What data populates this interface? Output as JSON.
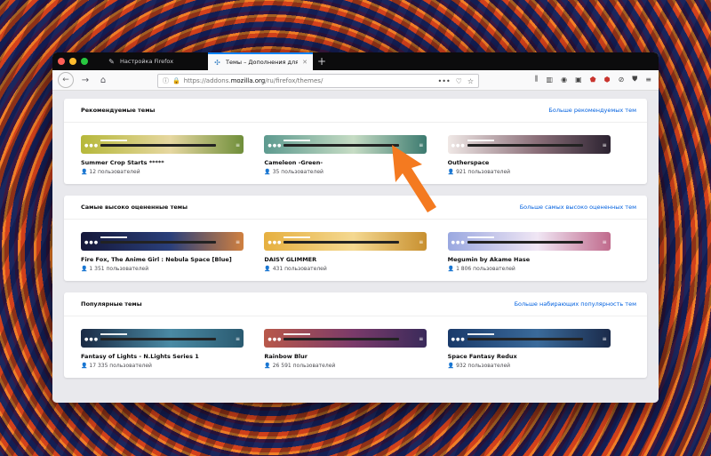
{
  "browser": {
    "tabs": [
      {
        "label": "Настройка Firefox",
        "icon": "wrench-icon",
        "close": "✕"
      },
      {
        "label": "Темы – Дополнения для Firefox",
        "icon": "puzzle-icon",
        "close": "✕"
      }
    ],
    "new_tab": "+",
    "url_prefix": "https://addons.",
    "url_domain": "mozilla.org",
    "url_path": "/ru/firefox/themes/",
    "page_actions": "•••"
  },
  "sections": [
    {
      "title": "Рекомендуемые темы",
      "more": "Больше рекомендуемых тем",
      "themes": [
        {
          "name": "Summer Crop Starts *****",
          "users": "12 пользователей",
          "colors": [
            "#b6b83a",
            "#e6d7a0",
            "#6f8e3a"
          ]
        },
        {
          "name": "Cameleon -Green-",
          "users": "35 пользователей",
          "colors": [
            "#5d9a8f",
            "#c6dcc4",
            "#3c7a6f"
          ]
        },
        {
          "name": "Outherspace",
          "users": "921 пользователей",
          "colors": [
            "#f0e8e6",
            "#8a6e78",
            "#2b2230"
          ]
        }
      ]
    },
    {
      "title": "Самые высоко оцененные темы",
      "more": "Больше самых высоко оцененных тем",
      "themes": [
        {
          "name": "Fire Fox, The Anime Girl : Nebula Space [Blue]",
          "users": "1 351 пользователей",
          "colors": [
            "#15183a",
            "#2a3f7a",
            "#d08040"
          ]
        },
        {
          "name": "DAISY GLIMMER",
          "users": "431 пользователей",
          "colors": [
            "#e6b040",
            "#f4d890",
            "#c89030"
          ]
        },
        {
          "name": "Megumin by Akame Hase",
          "users": "1 806 пользователей",
          "colors": [
            "#9aa8e0",
            "#f0e6f4",
            "#c06a8c"
          ]
        }
      ]
    },
    {
      "title": "Популярные темы",
      "more": "Больше набирающих популярность тем",
      "themes": [
        {
          "name": "Fantasy of Lights - N.Lights Series 1",
          "users": "17 335 пользователей",
          "colors": [
            "#1a2a44",
            "#4a8aa4",
            "#2a5a70"
          ]
        },
        {
          "name": "Rainbow Blur",
          "users": "26 591 пользователей",
          "colors": [
            "#b8584a",
            "#7a3a6a",
            "#3a2a5a"
          ]
        },
        {
          "name": "Space Fantasy Redux",
          "users": "932 пользователей",
          "colors": [
            "#1a3a6a",
            "#3a6a9a",
            "#1a2a4a"
          ]
        }
      ]
    }
  ],
  "colors": {
    "accent": "#0060df",
    "arrow": "#f47a20"
  }
}
